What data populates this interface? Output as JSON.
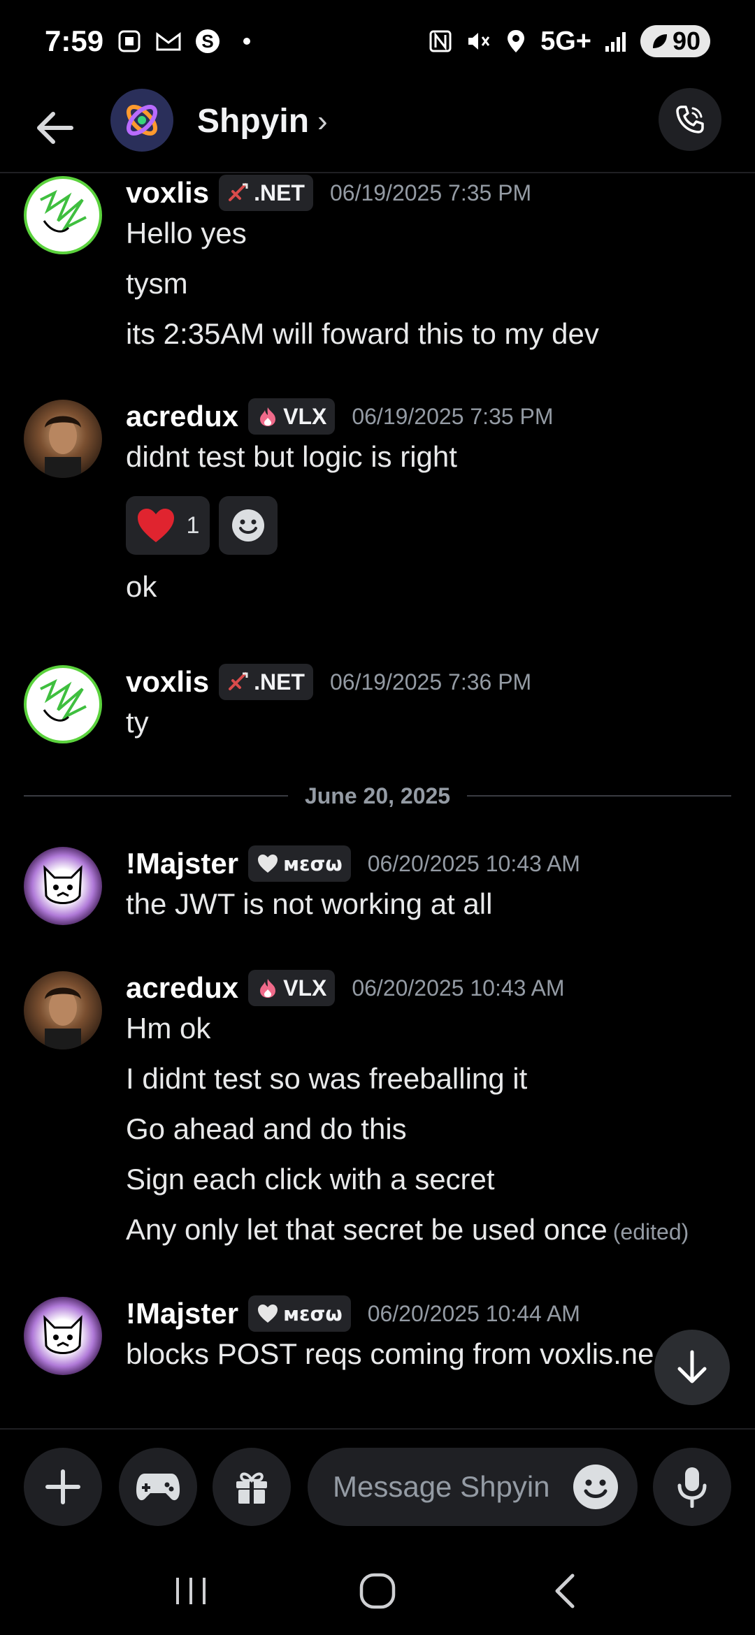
{
  "status_bar": {
    "time": "7:59",
    "network": "5G+",
    "battery": "90"
  },
  "header": {
    "channel_name": "Shpyin",
    "chevron": "›"
  },
  "messages": [
    {
      "username": "voxlis",
      "tag": ".NET",
      "timestamp": "06/19/2025 7:35 PM",
      "lines": [
        "Hello yes",
        "tysm",
        "its 2:35AM will foward this to my dev"
      ]
    },
    {
      "username": "acredux",
      "tag": "VLX",
      "timestamp": "06/19/2025 7:35 PM",
      "lines": [
        "didnt test but logic is right",
        "ok"
      ],
      "reaction": {
        "count": "1"
      }
    },
    {
      "username": "voxlis",
      "tag": ".NET",
      "timestamp": "06/19/2025 7:36 PM",
      "lines": [
        "ty"
      ]
    },
    {
      "username": "!Majster",
      "tag": "мεσω",
      "timestamp": "06/20/2025 10:43 AM",
      "lines": [
        "the JWT is not working at all"
      ]
    },
    {
      "username": "acredux",
      "tag": "VLX",
      "timestamp": "06/20/2025 10:43 AM",
      "lines": [
        "Hm ok",
        "I didnt test so was freeballing it",
        "Go ahead and do this",
        "Sign each click with a secret",
        "Any only let that secret be used once"
      ],
      "edited": "(edited)"
    },
    {
      "username": "!Majster",
      "tag": "мεσω",
      "timestamp": "06/20/2025 10:44 AM",
      "lines": [
        "blocks POST reqs coming from voxlis.ne"
      ]
    }
  ],
  "date_divider": "June 20, 2025",
  "composer": {
    "placeholder": "Message Shpyin"
  },
  "colors": {
    "background": "#000000",
    "surface": "#1f2024",
    "muted_text": "#949ba4",
    "heart": "#e0242f",
    "net_badge": "#d94b4b"
  }
}
